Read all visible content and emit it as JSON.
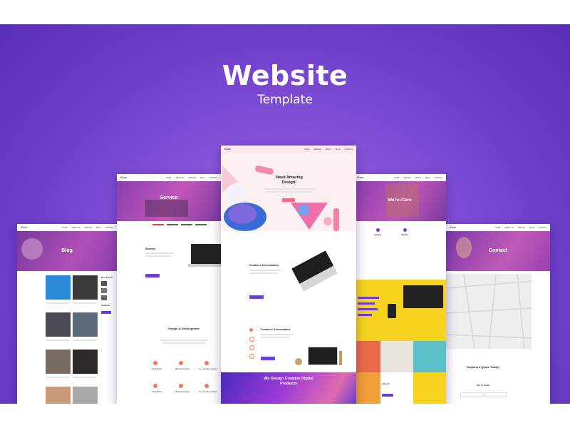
{
  "hero": {
    "title": "Website",
    "subtitle": "Template"
  },
  "pages": {
    "blog": {
      "logo": "iCore",
      "nav": [
        "HOME",
        "ABOUT US",
        "SERVICE",
        "BLOG",
        "CONTACT"
      ],
      "banner_title": "Blog",
      "sidebar_title": "Recent Posts",
      "sidebar_title2": "Newsletter"
    },
    "service": {
      "logo": "iCore",
      "nav": [
        "HOME",
        "ABOUT US",
        "SERVICE",
        "BLOG",
        "CONTACT"
      ],
      "banner_title": "Service",
      "section_title": "Service",
      "design_title": "Design & Development",
      "features": [
        "Visual Builder",
        "Responsive Design",
        "Free Support & Updates",
        "Visual Builder",
        "Responsive Design",
        "Free Support & Updates"
      ]
    },
    "home": {
      "logo": "iCore",
      "nav": [
        "HOME",
        "SERVICE",
        "ABOUT",
        "BLOG",
        "CONTACT"
      ],
      "headline": "Need Amazing Design!",
      "section1": "Creations & Innovations",
      "section2": "Creations & Innovations",
      "footer_title": "We Design Creative Digital Products"
    },
    "about": {
      "logo": "iCore",
      "nav": [
        "HOME",
        "SERVICE",
        "ABOUT",
        "BLOG",
        "CONTACT"
      ],
      "banner_title": "We're iCore",
      "features": [
        "Intuitive",
        "Modern"
      ],
      "join": "Join Us"
    },
    "contact": {
      "logo": "iCore",
      "nav": [
        "HOME",
        "ABOUT US",
        "SERVICE",
        "BLOG",
        "CONTACT"
      ],
      "banner_title": "Contact",
      "quote_title": "Request a Quote Today!",
      "touch": "Get In Touch"
    }
  },
  "colors": {
    "accent": "#6b3fd6",
    "purple_overlay": "#8a3fb8",
    "coral": "#f07a5a",
    "yellow": "#f7d31f"
  }
}
